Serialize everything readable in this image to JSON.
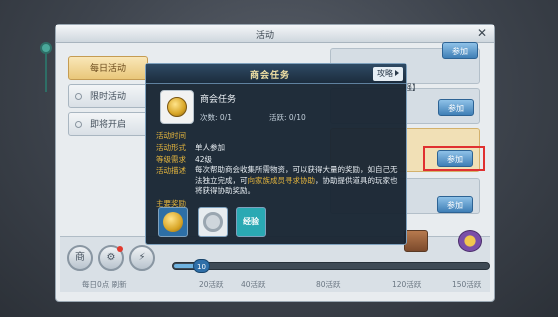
{
  "window": {
    "title": "活动",
    "close_glyph": "✕"
  },
  "tabs": [
    {
      "label": "每日活动",
      "selected": true
    },
    {
      "label": "限时活动",
      "selected": false
    },
    {
      "label": "即将开启",
      "selected": false
    }
  ],
  "rows": {
    "snippet": "强】",
    "join_label": "参加"
  },
  "popup": {
    "title": "商会任务",
    "guide_label": "攻略",
    "task_name": "商会任务",
    "count": "次数: 0/1",
    "activity": "活跃: 0/10",
    "time_key": "活动时间",
    "form_key": "活动形式",
    "form_value": "单人参加",
    "level_key": "等级需求",
    "level_value": "42级",
    "desc_key": "活动描述",
    "desc_before": "每次帮助商会收集所需物资，可以获得大量的奖励，如自己无法独立完成，可",
    "desc_highlight": "向家族成员寻求协助",
    "desc_after": "，协助提供道具的玩家也将获得协助奖励。",
    "reward_key": "主要奖励",
    "reward_exp_label": "经验"
  },
  "bottom": {
    "shop_glyph": "商",
    "gear_glyph": "⚙",
    "bolt_glyph": "⚡",
    "refresh_note": "每日0点 刷新",
    "progress_value": 10,
    "progress_max": 150,
    "milestones": [
      "20活跃",
      "40活跃",
      "80活跃",
      "120活跃",
      "150活跃"
    ]
  },
  "colors": {
    "accent_gold": "#e4b53d",
    "join_blue": "#3f7fb6",
    "highlight_red": "#e03030"
  },
  "icons": [
    "close-icon",
    "arrow-right-icon",
    "coin-icon",
    "ring-icon",
    "gear-icon",
    "bolt-icon",
    "chest-icon"
  ]
}
